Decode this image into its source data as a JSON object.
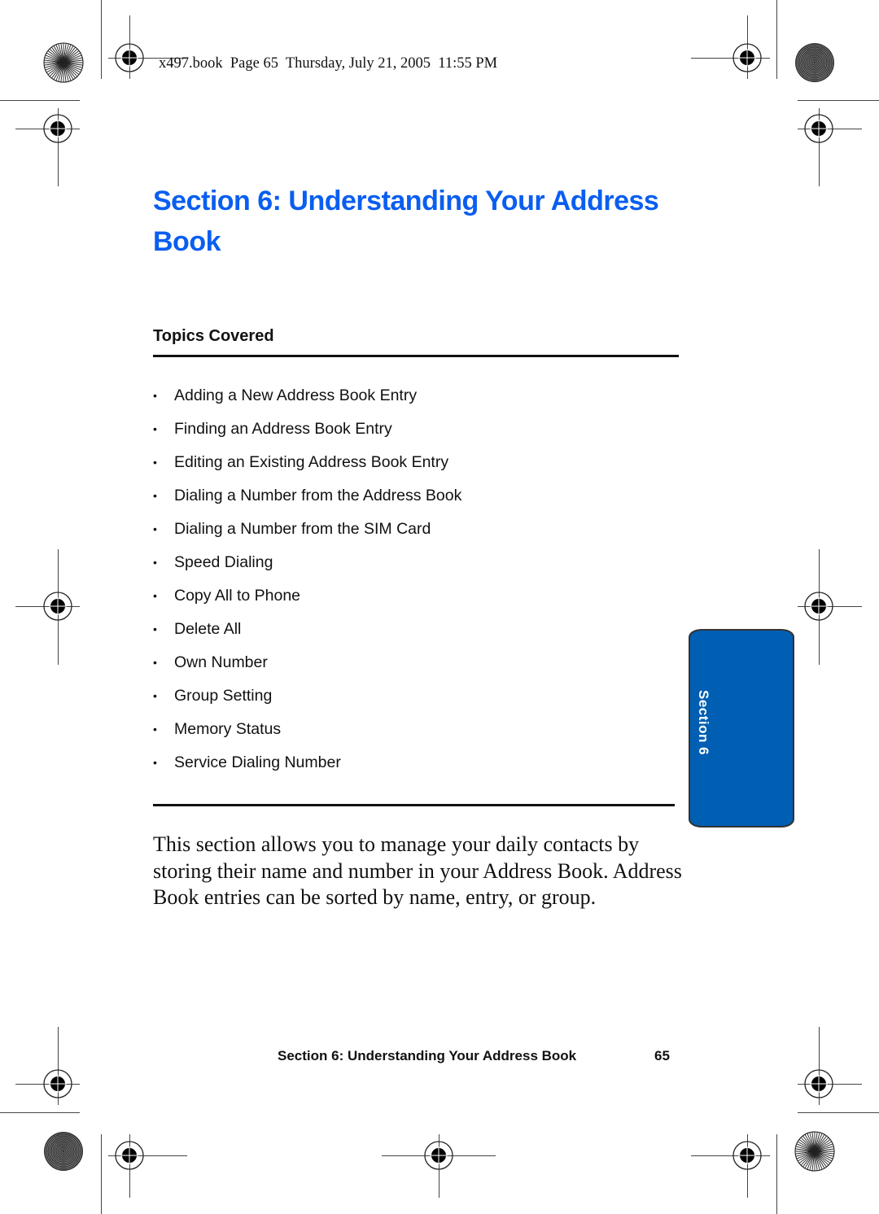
{
  "slug": "x497.book  Page 65  Thursday, July 21, 2005  11:55 PM",
  "title": {
    "line1": "Section 6: Understanding Your Address",
    "line2": "Book"
  },
  "topics": {
    "heading": "Topics Covered",
    "bullet": "•",
    "items": [
      "Adding a New Address Book Entry",
      "Finding an Address Book Entry",
      "Editing an Existing Address Book Entry",
      "Dialing a Number from the Address Book",
      "Dialing a Number from the SIM Card",
      "Speed Dialing",
      "Copy All to Phone",
      "Delete All",
      "Own Number",
      "Group Setting",
      "Memory Status",
      "Service Dialing Number"
    ]
  },
  "side_tab": {
    "label": "Section 6",
    "color": "#005eb3"
  },
  "body": "This section allows you to manage your daily contacts by storing their name and number in your Address Book. Address Book entries can be sorted by name, entry, or group.",
  "footer": {
    "title": "Section 6: Understanding Your Address Book",
    "page": "65"
  },
  "colors": {
    "title": "#0a5ef0",
    "text": "#111111"
  }
}
